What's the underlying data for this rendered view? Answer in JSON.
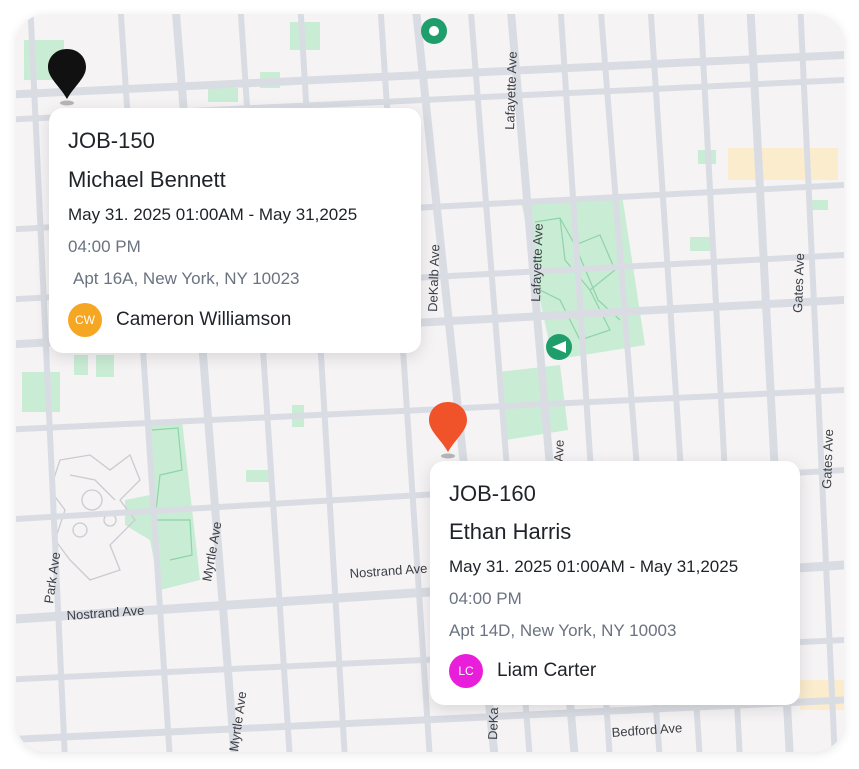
{
  "map": {
    "streets": {
      "lafayette_ave_north": "Lafayette Ave",
      "lafayette_ave_mid": "Lafayette Ave",
      "dekalb_ave": "DeKalb Ave",
      "gates_ave_upper": "Gates Ave",
      "gates_ave_lower": "Gates Ave",
      "myrtle_ave_mid": "Myrtle Ave",
      "myrtle_ave_bottom": "Myrtle Ave",
      "park_ave": "Park Ave",
      "nostrand_ave_left": "Nostrand Ave",
      "nostrand_ave_center": "Nostrand Ave",
      "bedford_ave": "Bedford Ave",
      "ave_partial": "Ave",
      "dekalb_partial": "DeKa"
    },
    "colors": {
      "background": "#f5f3f4",
      "road": "#d9dde3",
      "park": "#c9ecd4",
      "highlight": "#fbeccd",
      "pin_black": "#111111",
      "pin_orange": "#f0522a",
      "poi_green": "#1f9d6b"
    }
  },
  "jobs": [
    {
      "id": "JOB-150",
      "client": "Michael Bennett",
      "time_line1": "May 31. 2025 01:00AM - May 31,2025",
      "time_line2": "04:00 PM",
      "address": "Apt 16A, New York, NY 10023",
      "assignee": {
        "initials": "CW",
        "name": "Cameron Williamson",
        "color": "#f5a623"
      },
      "pin_color": "#111111"
    },
    {
      "id": "JOB-160",
      "client": "Ethan Harris",
      "time_line1": "May 31. 2025 01:00AM - May 31,2025",
      "time_line2": "04:00 PM",
      "address": "Apt 14D, New York, NY 10003",
      "assignee": {
        "initials": "LC",
        "name": "Liam Carter",
        "color": "#e91eda"
      },
      "pin_color": "#f0522a"
    }
  ]
}
